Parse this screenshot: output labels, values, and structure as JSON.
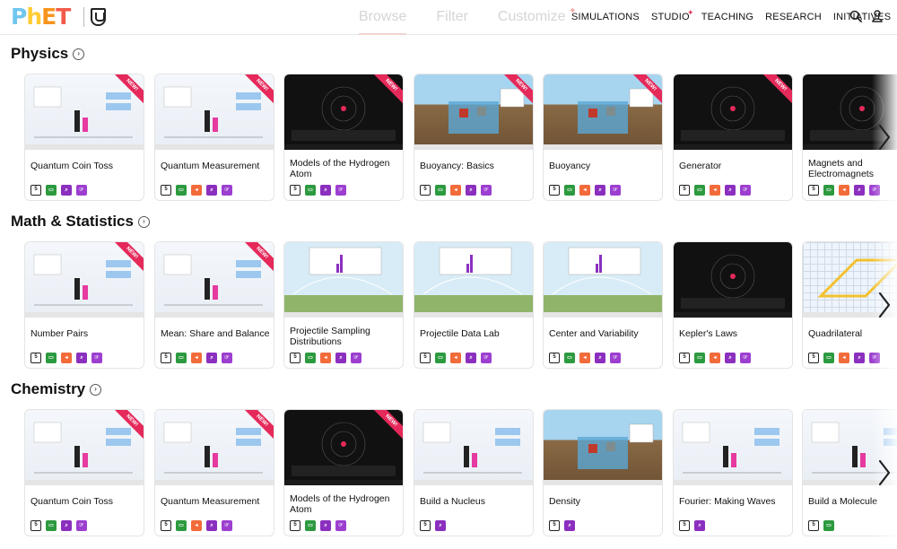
{
  "header": {
    "logo_text": "PhET",
    "mid_tabs": [
      {
        "label": "Browse",
        "active": true
      },
      {
        "label": "Filter",
        "active": false
      },
      {
        "label": "Customize",
        "active": false
      }
    ],
    "nav": [
      "SIMULATIONS",
      "STUDIO",
      "TEACHING",
      "RESEARCH",
      "INITIATIVES"
    ],
    "icons": [
      "search-icon",
      "user-icon"
    ]
  },
  "sections": [
    {
      "title": "Physics",
      "cards": [
        {
          "title": "Quantum Coin Toss",
          "new": true,
          "thumb": "light",
          "icons": [
            "html5",
            "green",
            "purple",
            "purple2"
          ]
        },
        {
          "title": "Quantum Measurement",
          "new": true,
          "thumb": "light",
          "icons": [
            "html5",
            "green",
            "orange",
            "purple",
            "purple2"
          ]
        },
        {
          "title": "Models of the Hydrogen Atom",
          "new": true,
          "thumb": "dark",
          "icons": [
            "html5",
            "green",
            "purple",
            "purple2"
          ]
        },
        {
          "title": "Buoyancy: Basics",
          "new": true,
          "thumb": "scene",
          "icons": [
            "html5",
            "green",
            "orange",
            "purple",
            "purple2"
          ]
        },
        {
          "title": "Buoyancy",
          "new": true,
          "thumb": "scene",
          "icons": [
            "html5",
            "green",
            "orange",
            "purple",
            "purple2"
          ]
        },
        {
          "title": "Generator",
          "new": true,
          "thumb": "dark",
          "icons": [
            "html5",
            "green",
            "orange",
            "purple",
            "purple2"
          ]
        },
        {
          "title": "Magnets and Electromagnets",
          "new": false,
          "thumb": "dark",
          "icons": [
            "html5",
            "green",
            "orange",
            "purple",
            "purple2"
          ]
        }
      ]
    },
    {
      "title": "Math & Statistics",
      "cards": [
        {
          "title": "Number Pairs",
          "new": true,
          "thumb": "light",
          "icons": [
            "html5",
            "green",
            "orange",
            "purple",
            "purple2"
          ]
        },
        {
          "title": "Mean: Share and Balance",
          "new": true,
          "thumb": "light",
          "icons": [
            "html5",
            "green",
            "orange",
            "purple",
            "purple2"
          ]
        },
        {
          "title": "Projectile Sampling Distributions",
          "new": false,
          "thumb": "sky",
          "icons": [
            "html5",
            "green",
            "orange",
            "purple",
            "purple2"
          ]
        },
        {
          "title": "Projectile Data Lab",
          "new": false,
          "thumb": "sky",
          "icons": [
            "html5",
            "green",
            "orange",
            "purple",
            "purple2"
          ]
        },
        {
          "title": "Center and Variability",
          "new": false,
          "thumb": "sky",
          "icons": [
            "html5",
            "green",
            "orange",
            "purple",
            "purple2"
          ]
        },
        {
          "title": "Kepler's Laws",
          "new": false,
          "thumb": "dark",
          "icons": [
            "html5",
            "green",
            "orange",
            "purple",
            "purple2"
          ]
        },
        {
          "title": "Quadrilateral",
          "new": false,
          "thumb": "grid",
          "icons": [
            "html5",
            "green",
            "orange",
            "purple",
            "purple2"
          ]
        }
      ]
    },
    {
      "title": "Chemistry",
      "cards": [
        {
          "title": "Quantum Coin Toss",
          "new": true,
          "thumb": "light",
          "icons": [
            "html5",
            "green",
            "purple",
            "purple2"
          ]
        },
        {
          "title": "Quantum Measurement",
          "new": true,
          "thumb": "light",
          "icons": [
            "html5",
            "green",
            "orange",
            "purple",
            "purple2"
          ]
        },
        {
          "title": "Models of the Hydrogen Atom",
          "new": true,
          "thumb": "dark",
          "icons": [
            "html5",
            "green",
            "purple",
            "purple2"
          ]
        },
        {
          "title": "Build a Nucleus",
          "new": false,
          "thumb": "light",
          "icons": [
            "html5",
            "purple"
          ]
        },
        {
          "title": "Density",
          "new": false,
          "thumb": "scene",
          "icons": [
            "html5",
            "purple"
          ]
        },
        {
          "title": "Fourier: Making Waves",
          "new": false,
          "thumb": "light",
          "icons": [
            "html5",
            "purple"
          ]
        },
        {
          "title": "Build a Molecule",
          "new": false,
          "thumb": "light",
          "icons": [
            "html5",
            "green"
          ]
        }
      ]
    }
  ],
  "ribbon_label": "NEW!",
  "colors": {
    "ribbon": "#e5295a",
    "sim_green": "#2c9a3f",
    "sim_orange": "#f26b3a",
    "sim_purple": "#8b2fbf"
  }
}
